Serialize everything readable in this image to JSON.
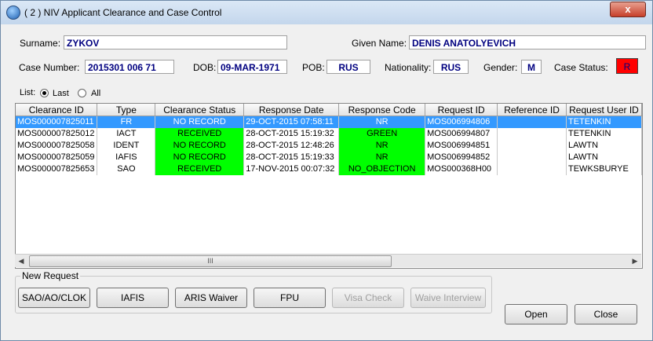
{
  "window": {
    "title": "( 2 ) NIV Applicant Clearance and Case Control",
    "close": "x"
  },
  "applicant": {
    "surname_label": "Surname:",
    "surname": "ZYKOV",
    "given_label": "Given Name:",
    "given": "DENIS ANATOLYEVICH",
    "case_label": "Case Number:",
    "case_number": "2015301 006 71",
    "dob_label": "DOB:",
    "dob": "09-MAR-1971",
    "pob_label": "POB:",
    "pob": "RUS",
    "nationality_label": "Nationality:",
    "nationality": "RUS",
    "gender_label": "Gender:",
    "gender": "M",
    "status_label": "Case Status:",
    "status": "R"
  },
  "list": {
    "label": "List:",
    "last": "Last",
    "all": "All",
    "selected": "Last"
  },
  "table": {
    "headers": [
      "Clearance ID",
      "Type",
      "Clearance Status",
      "Response Date",
      "Response Code",
      "Request ID",
      "Reference ID",
      "Request User ID"
    ],
    "rows": [
      {
        "id": "MOS000007825011",
        "type": "FR",
        "status": "NO RECORD",
        "date": "29-OCT-2015 07:58:11",
        "code": "NR",
        "req": "MOS006994806",
        "ref": "",
        "user": "TETENKIN"
      },
      {
        "id": "MOS000007825012",
        "type": "IACT",
        "status": "RECEIVED",
        "date": "28-OCT-2015 15:19:32",
        "code": "GREEN",
        "req": "MOS006994807",
        "ref": "",
        "user": "TETENKIN"
      },
      {
        "id": "MOS000007825058",
        "type": "IDENT",
        "status": "NO RECORD",
        "date": "28-OCT-2015 12:48:26",
        "code": "NR",
        "req": "MOS006994851",
        "ref": "",
        "user": "LAWTN"
      },
      {
        "id": "MOS000007825059",
        "type": "IAFIS",
        "status": "NO RECORD",
        "date": "28-OCT-2015 15:19:33",
        "code": "NR",
        "req": "MOS006994852",
        "ref": "",
        "user": "LAWTN"
      },
      {
        "id": "MOS000007825653",
        "type": "SAO",
        "status": "RECEIVED",
        "date": "17-NOV-2015 00:07:32",
        "code": "NO_OBJECTION",
        "req": "MOS000368H00",
        "ref": "",
        "user": "TEWKSBURYE"
      }
    ],
    "scroll_thumb": "III"
  },
  "new_request": {
    "legend": "New Request",
    "buttons": [
      "SAO/AO/CLOK",
      "IAFIS",
      "ARIS Waiver",
      "FPU",
      "Visa Check",
      "Waive Interview"
    ]
  },
  "actions": {
    "open": "Open",
    "close": "Close"
  },
  "colors": {
    "highlight": "#00ff00",
    "selected": "#3399ff",
    "status_bg": "#ff0000"
  }
}
